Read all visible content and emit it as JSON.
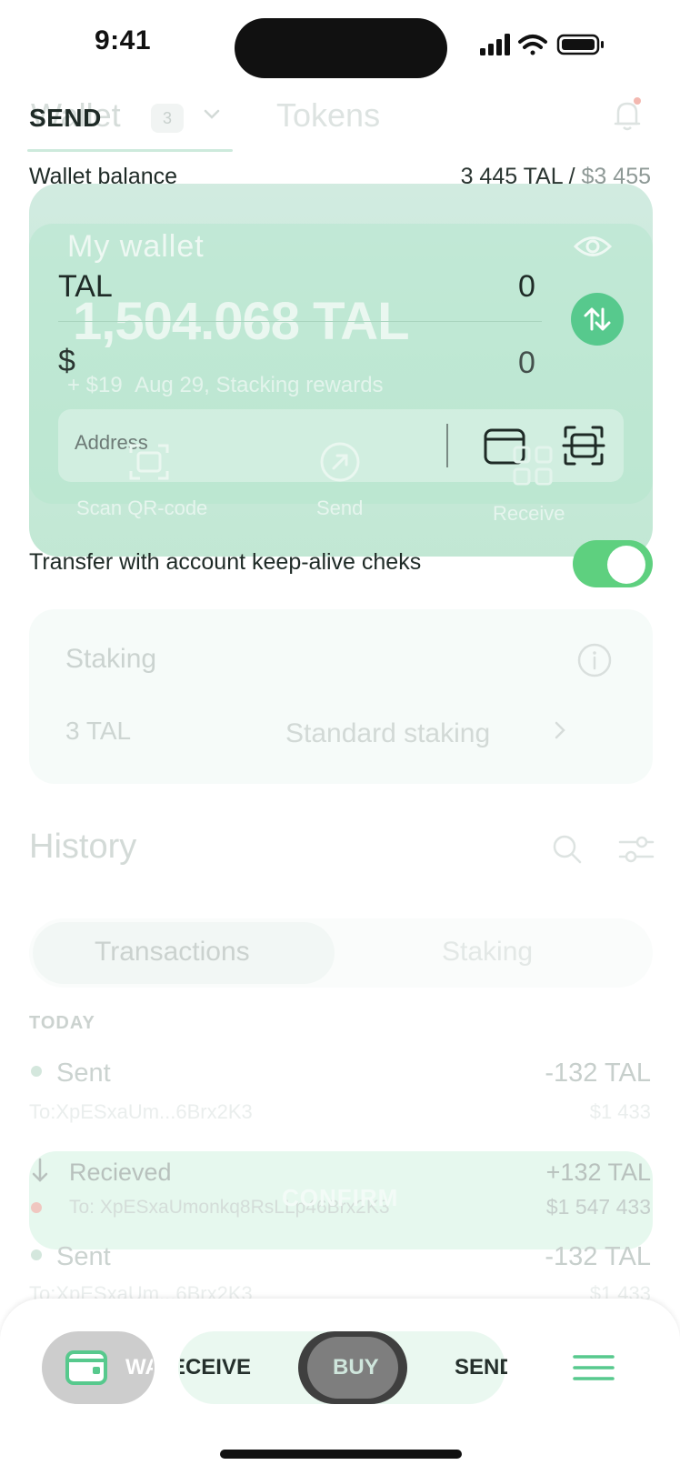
{
  "status_bar": {
    "time": "9:41"
  },
  "background_app": {
    "tabs": [
      {
        "label": "Wallet",
        "count": "3"
      },
      {
        "label": "Tokens"
      }
    ],
    "wallet_card": {
      "title": "My wallet",
      "balance": "1,504.068 TAL",
      "rewards_change": "+ $19",
      "rewards_text": "Aug 29, Stacking rewards",
      "actions": [
        {
          "label": "Scan QR-code",
          "icon": "scan-qr-icon"
        },
        {
          "label": "Send",
          "icon": "send-arrow-icon"
        },
        {
          "label": "Receive",
          "icon": "qr-code-icon"
        }
      ]
    },
    "staking": {
      "title": "Staking",
      "amount": "3 TAL",
      "type": "Standard staking"
    },
    "history": {
      "title": "History",
      "segments": [
        "Transactions",
        "Staking"
      ],
      "day_label": "TODAY",
      "transactions": [
        {
          "title": "Sent",
          "amount": "-132 TAL",
          "to": "To:XpESxaUm...6Brx2K3",
          "usd": "$1 433"
        },
        {
          "title": "Recieved",
          "amount": "+132 TAL",
          "to": "To: XpESxaUmonkq8RsLLp46Brx2K3",
          "usd": "$1 547 433"
        },
        {
          "title": "Sent",
          "amount": "-132 TAL",
          "to": "To:XpESxaUm...6Brx2K3",
          "usd": "$1 433"
        }
      ]
    }
  },
  "send_form": {
    "title": "SEND",
    "balance_label": "Wallet balance",
    "balance_tal": "3 445 TAL /",
    "balance_usd": "$3 455",
    "token_label": "TAL",
    "token_value": "0",
    "usd_label": "$",
    "usd_value": "0",
    "address_placeholder": "Address",
    "keep_alive_label": "Transfer with account keep-alive cheks",
    "keep_alive_on": true,
    "confirm_label": "CONFIRM"
  },
  "bottom_nav": {
    "wallet_label": "WALLET",
    "receive_label": "RECEIVE",
    "buy_label": "BUY",
    "send_label": "SEND"
  },
  "colors": {
    "accent_green": "#57c98d",
    "toggle_green": "#5ed07f",
    "card_green": "#c4e8d7"
  }
}
